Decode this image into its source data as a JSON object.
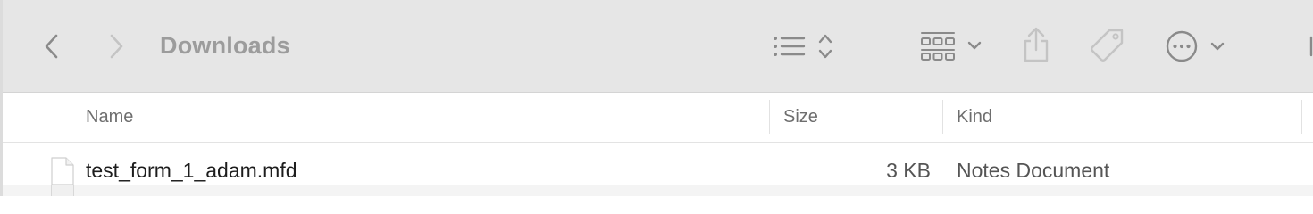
{
  "window": {
    "title": "Downloads"
  },
  "toolbar": {
    "back_icon": "chevron-left-icon",
    "forward_icon": "chevron-right-icon",
    "view_list_icon": "list-view-icon",
    "sort_icon": "up-down-chevron-icon",
    "group_icon": "grid-group-icon",
    "share_icon": "share-icon",
    "tag_icon": "tag-icon",
    "more_icon": "ellipsis-circle-icon"
  },
  "columns": {
    "name": "Name",
    "size": "Size",
    "kind": "Kind"
  },
  "files": [
    {
      "name": "test_form_1_adam.mfd",
      "size": "3 KB",
      "kind": "Notes Document",
      "icon": "document-icon"
    }
  ],
  "colors": {
    "toolbar_bg": "#e6e6e6",
    "icon_gray": "#8a8a8a",
    "icon_disabled": "#c4c4c4",
    "title_gray": "#9c9c9c",
    "text": "#1d1d1d"
  }
}
